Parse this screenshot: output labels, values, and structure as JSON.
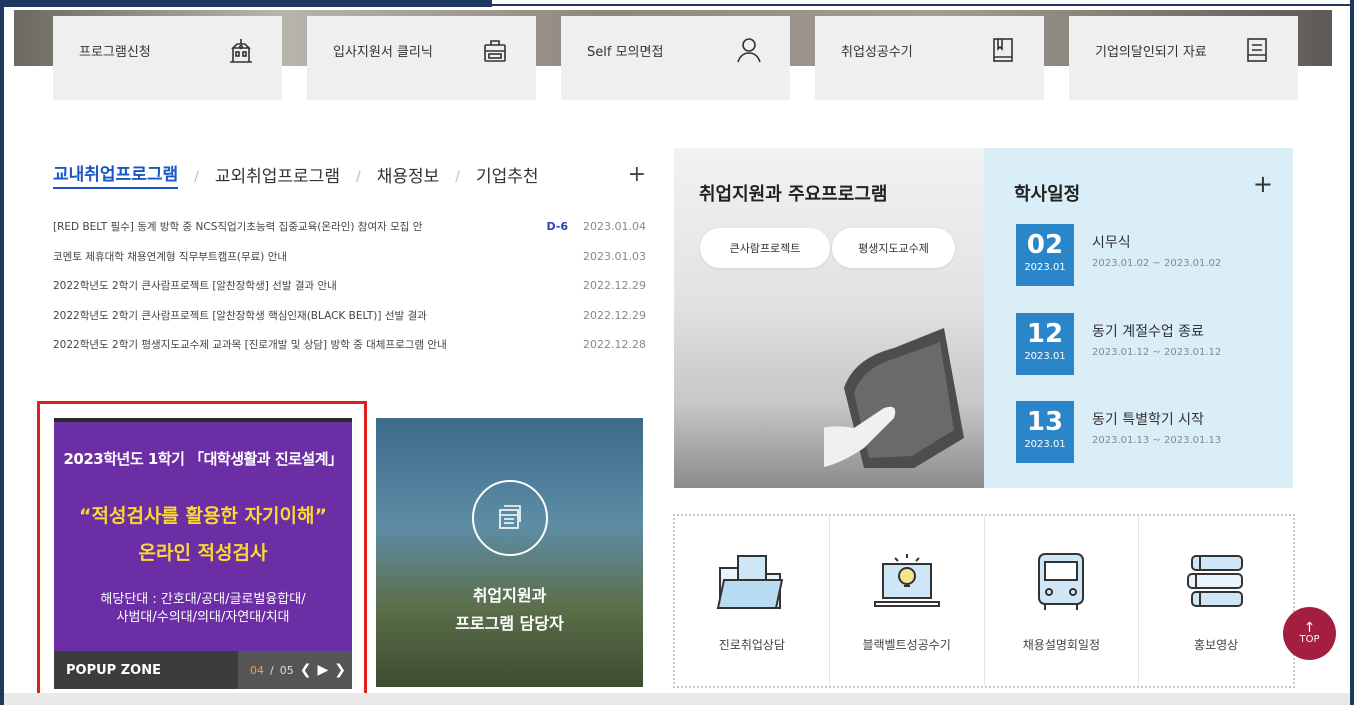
{
  "quick_menu": [
    {
      "label": "프로그램신청",
      "icon": "building-icon"
    },
    {
      "label": "입사지원서 클리닉",
      "icon": "briefcase-icon"
    },
    {
      "label": "Self 모의면접",
      "icon": "person-icon"
    },
    {
      "label": "취업성공수기",
      "icon": "book-icon"
    },
    {
      "label": "기업의달인되기 자료",
      "icon": "document-icon"
    }
  ],
  "tabs": {
    "items": [
      "교내취업프로그램",
      "교외취업프로그램",
      "채용정보",
      "기업추천"
    ],
    "more": "+"
  },
  "notices": [
    {
      "title": "[RED BELT 필수] 동계 방학 중 NCS직업기초능력 집중교육(온라인) 참여자 모집 안",
      "badge": "D-6",
      "date": "2023.01.04"
    },
    {
      "title": "코멘토 제휴대학 채용연계형 직무부트캠프(무료) 안내",
      "badge": "",
      "date": "2023.01.03"
    },
    {
      "title": "2022학년도 2학기 큰사람프로젝트 [알찬장학생] 선발 결과 안내",
      "badge": "",
      "date": "2022.12.29"
    },
    {
      "title": "2022학년도 2학기 큰사람프로젝트 [알찬장학생 핵심인재(BLACK BELT)] 선발 결과",
      "badge": "",
      "date": "2022.12.29"
    },
    {
      "title": "2022학년도 2학기 평생지도교수제 교과목 [진로개발 및 상담] 방학 중 대체프로그램 안내",
      "badge": "",
      "date": "2022.12.28"
    }
  ],
  "popup": {
    "line1": "2023학년도 1학기 「대학생활과 진로설계」",
    "line2": "“적성검사를 활용한 자기이해”",
    "line3": "온라인 적성검사",
    "line4a": "해당단대 : 간호대/공대/글로벌융합대/",
    "line4b": "사범대/수의대/의대/자연대/치대",
    "zone_label": "POPUP ZONE",
    "page_current": "04",
    "page_sep": "/",
    "page_total": "05",
    "prev": "❮",
    "play": "▶",
    "next": "❯"
  },
  "program_box": {
    "line1": "취업지원과",
    "line2": "프로그램 담당자"
  },
  "main_program": {
    "title": "취업지원과 주요프로그램",
    "buttons": [
      "큰사람프로젝트",
      "평생지도교수제"
    ]
  },
  "calendar": {
    "title": "학사일정",
    "more": "+",
    "events": [
      {
        "day": "02",
        "ym": "2023.01",
        "event": "시무식",
        "range": "2023.01.02 ~ 2023.01.02"
      },
      {
        "day": "12",
        "ym": "2023.01",
        "event": "동기 계절수업 종료",
        "range": "2023.01.12 ~ 2023.01.12"
      },
      {
        "day": "13",
        "ym": "2023.01",
        "event": "동기 특별학기 시작",
        "range": "2023.01.13 ~ 2023.01.13"
      }
    ]
  },
  "quick_links": [
    {
      "label": "진로취업상담",
      "icon": "folder-icon"
    },
    {
      "label": "블랙벨트성공수기",
      "icon": "laptop-bulb-icon"
    },
    {
      "label": "채용설명회일정",
      "icon": "bus-icon"
    },
    {
      "label": "홍보영상",
      "icon": "books-icon"
    }
  ],
  "top_button": {
    "arrow": "↑",
    "label": "TOP"
  },
  "colors": {
    "accent": "#1a57c4",
    "popup_bg": "#6b2ea4",
    "popup_highlight": "#f9d835",
    "calendar_bg": "#daeef7",
    "date_box": "#2a86c8",
    "top_button": "#a41f3f",
    "frame": "#1f3a5f"
  }
}
